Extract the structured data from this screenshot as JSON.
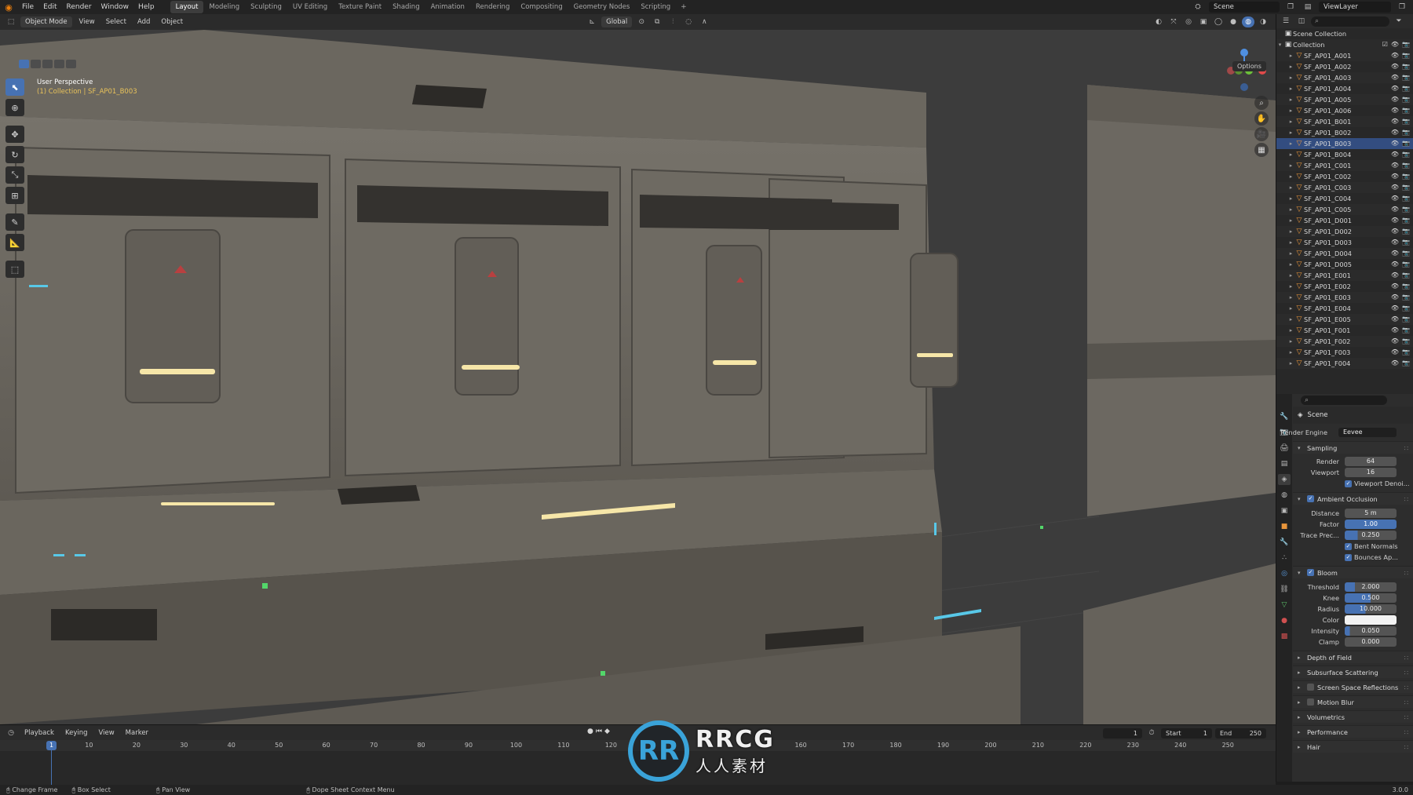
{
  "menubar": {
    "items": [
      "File",
      "Edit",
      "Render",
      "Window",
      "Help"
    ],
    "workspaces": [
      "Layout",
      "Modeling",
      "Sculpting",
      "UV Editing",
      "Texture Paint",
      "Shading",
      "Animation",
      "Rendering",
      "Compositing",
      "Geometry Nodes",
      "Scripting"
    ],
    "active_workspace": "Layout",
    "scene_label": "Scene",
    "view_layer_label": "ViewLayer"
  },
  "viewport_header": {
    "mode": "Object Mode",
    "menus": [
      "View",
      "Select",
      "Add",
      "Object"
    ],
    "transform_orientation": "Global",
    "options_label": "Options"
  },
  "viewport": {
    "view_name": "User Perspective",
    "collection_info": "(1) Collection | SF_AP01_B003"
  },
  "outliner": {
    "scene_collection": "Scene Collection",
    "collection": "Collection",
    "selected_item": "SF_AP01_B003",
    "items": [
      "SF_AP01_A001",
      "SF_AP01_A002",
      "SF_AP01_A003",
      "SF_AP01_A004",
      "SF_AP01_A005",
      "SF_AP01_A006",
      "SF_AP01_B001",
      "SF_AP01_B002",
      "SF_AP01_B003",
      "SF_AP01_B004",
      "SF_AP01_C001",
      "SF_AP01_C002",
      "SF_AP01_C003",
      "SF_AP01_C004",
      "SF_AP01_C005",
      "SF_AP01_D001",
      "SF_AP01_D002",
      "SF_AP01_D003",
      "SF_AP01_D004",
      "SF_AP01_D005",
      "SF_AP01_E001",
      "SF_AP01_E002",
      "SF_AP01_E003",
      "SF_AP01_E004",
      "SF_AP01_E005",
      "SF_AP01_F001",
      "SF_AP01_F002",
      "SF_AP01_F003",
      "SF_AP01_F004"
    ]
  },
  "properties": {
    "context": "Scene",
    "render_engine_label": "Render Engine",
    "render_engine": "Eevee",
    "sampling": {
      "title": "Sampling",
      "render_label": "Render",
      "render": "64",
      "viewport_label": "Viewport",
      "viewport": "16",
      "denoise_label": "Viewport Denoi..."
    },
    "ao": {
      "title": "Ambient Occlusion",
      "distance_label": "Distance",
      "distance": "5 m",
      "factor_label": "Factor",
      "factor": "1.00",
      "trace_label": "Trace Prec...",
      "trace": "0.250",
      "bent_label": "Bent Normals",
      "bounces_label": "Bounces Ap..."
    },
    "bloom": {
      "title": "Bloom",
      "threshold_label": "Threshold",
      "threshold": "2.000",
      "knee_label": "Knee",
      "knee": "0.500",
      "radius_label": "Radius",
      "radius": "10.000",
      "color_label": "Color",
      "color": "#f2f2f2",
      "intensity_label": "Intensity",
      "intensity": "0.050",
      "clamp_label": "Clamp",
      "clamp": "0.000"
    },
    "panels": [
      "Depth of Field",
      "Subsurface Scattering",
      "Screen Space Reflections",
      "Motion Blur",
      "Volumetrics",
      "Performance",
      "Hair"
    ]
  },
  "timeline": {
    "menus": [
      "Playback",
      "Keying",
      "View",
      "Marker"
    ],
    "current_frame": "1",
    "start_label": "Start",
    "start": "1",
    "end_label": "End",
    "end": "250",
    "ticks": [
      "10",
      "20",
      "30",
      "40",
      "50",
      "60",
      "70",
      "80",
      "90",
      "100",
      "110",
      "120",
      "160",
      "170",
      "180",
      "190",
      "200",
      "210",
      "220",
      "230",
      "240",
      "250"
    ]
  },
  "statusbar": {
    "items": [
      "Change Frame",
      "Box Select",
      "Pan View",
      "Dope Sheet Context Menu"
    ],
    "version": "3.0.0"
  },
  "watermark": {
    "logo_text": "RR",
    "brand": "RRCG",
    "cn": "人人素材"
  },
  "colors": {
    "accent": "#4772b3",
    "mesh_icon": "#e8953b",
    "info_text": "#e8c25a"
  }
}
